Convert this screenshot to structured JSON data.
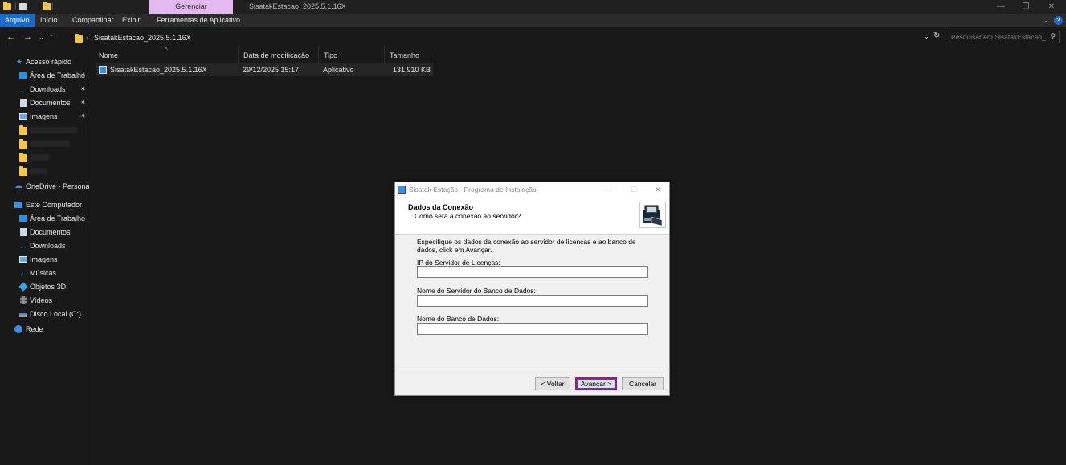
{
  "titlebar": {
    "manage_tab": "Gerenciar",
    "window_title": "SisatakEstacao_2025.5.1.16X"
  },
  "ribbon": {
    "tabs": [
      "Arquivo",
      "Início",
      "Compartilhar",
      "Exibir",
      "Ferramentas de Aplicativo"
    ]
  },
  "address": {
    "path": "SisatakEstacao_2025.5.1.16X",
    "search_placeholder": "Pesquisar em SisatakEstacao_..."
  },
  "nav": {
    "quick_access": "Acesso rápido",
    "pinned": [
      {
        "label": "Área de Trabalho",
        "icon": "desktop-icon"
      },
      {
        "label": "Downloads",
        "icon": "download-icon"
      },
      {
        "label": "Documentos",
        "icon": "document-icon"
      },
      {
        "label": "Imagens",
        "icon": "images-icon"
      }
    ],
    "onedrive": "OneDrive - Personal",
    "this_pc": "Este Computador",
    "pc_items": [
      {
        "label": "Área de Trabalho",
        "icon": "desktop-icon"
      },
      {
        "label": "Documentos",
        "icon": "document-icon"
      },
      {
        "label": "Downloads",
        "icon": "download-icon"
      },
      {
        "label": "Imagens",
        "icon": "images-icon"
      },
      {
        "label": "Músicas",
        "icon": "music-icon"
      },
      {
        "label": "Objetos 3D",
        "icon": "objects-3d-icon"
      },
      {
        "label": "Vídeos",
        "icon": "videos-icon"
      },
      {
        "label": "Disco Local (C:)",
        "icon": "drive-icon"
      }
    ],
    "network": "Rede"
  },
  "filelist": {
    "columns": [
      "Nome",
      "Data de modificação",
      "Tipo",
      "Tamanho"
    ],
    "rows": [
      {
        "name": "SisatakEstacao_2025.5.1.16X",
        "modified": "29/12/2025 15:17",
        "type": "Aplicativo",
        "size": "131.910 KB"
      }
    ]
  },
  "dialog": {
    "title": "Sisatak Estação - Programa de Instalação",
    "heading": "Dados da Conexão",
    "subheading": "Como será a conexão ao servidor?",
    "description": "Especifique os dados da conexão ao servidor de licenças e ao banco de dados, click em Avançar.",
    "fields": [
      {
        "label": "IP do Servidor de Licenças:",
        "value": ""
      },
      {
        "label": "Nome do Servidor do Banco de Dados:",
        "value": ""
      },
      {
        "label": "Nome do Banco de Dados:",
        "value": ""
      }
    ],
    "buttons": {
      "back": "< Voltar",
      "next": "Avançar >",
      "cancel": "Cancelar"
    }
  }
}
